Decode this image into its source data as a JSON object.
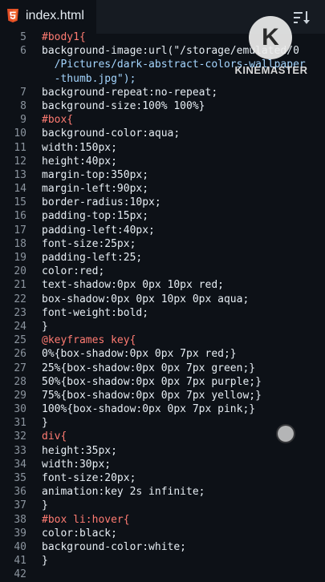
{
  "tab": {
    "title": "index.html",
    "icon": "html5-icon"
  },
  "toolbar": {
    "sort_icon": "sort-icon"
  },
  "watermark": {
    "letter": "K",
    "text": "KINEMASTER"
  },
  "code_lines": [
    {
      "n": "5",
      "text": "#body1{"
    },
    {
      "n": "6",
      "text": "background-image:url(\"/storage/emulated/0"
    },
    {
      "n": "",
      "text": "  /Pictures/dark-abstract-colors-wallpaper"
    },
    {
      "n": "",
      "text": "  -thumb.jpg\");"
    },
    {
      "n": "7",
      "text": "background-repeat:no-repeat;"
    },
    {
      "n": "8",
      "text": "background-size:100% 100%}"
    },
    {
      "n": "9",
      "text": "#box{"
    },
    {
      "n": "10",
      "text": "background-color:aqua;"
    },
    {
      "n": "11",
      "text": "width:150px;"
    },
    {
      "n": "12",
      "text": "height:40px;"
    },
    {
      "n": "13",
      "text": "margin-top:350px;"
    },
    {
      "n": "14",
      "text": "margin-left:90px;"
    },
    {
      "n": "15",
      "text": "border-radius:10px;"
    },
    {
      "n": "16",
      "text": "padding-top:15px;"
    },
    {
      "n": "17",
      "text": "padding-left:40px;"
    },
    {
      "n": "18",
      "text": "font-size:25px;"
    },
    {
      "n": "19",
      "text": "padding-left:25;"
    },
    {
      "n": "20",
      "text": "color:red;"
    },
    {
      "n": "21",
      "text": "text-shadow:0px 0px 10px red;"
    },
    {
      "n": "22",
      "text": "box-shadow:0px 0px 10px 0px aqua;"
    },
    {
      "n": "23",
      "text": "font-weight:bold;"
    },
    {
      "n": "24",
      "text": "}"
    },
    {
      "n": "25",
      "text": "@keyframes key{"
    },
    {
      "n": "26",
      "text": "0%{box-shadow:0px 0px 7px red;}"
    },
    {
      "n": "27",
      "text": "25%{box-shadow:0px 0px 7px green;}"
    },
    {
      "n": "28",
      "text": "50%{box-shadow:0px 0px 7px purple;}"
    },
    {
      "n": "29",
      "text": "75%{box-shadow:0px 0px 7px yellow;}"
    },
    {
      "n": "30",
      "text": "100%{box-shadow:0px 0px 7px pink;}"
    },
    {
      "n": "31",
      "text": "}"
    },
    {
      "n": "32",
      "text": "div{"
    },
    {
      "n": "33",
      "text": "height:35px;"
    },
    {
      "n": "34",
      "text": "width:30px;"
    },
    {
      "n": "35",
      "text": "font-size:20px;"
    },
    {
      "n": "36",
      "text": "animation:key 2s infinite;"
    },
    {
      "n": "37",
      "text": "}"
    },
    {
      "n": "38",
      "text": "#box li:hover{"
    },
    {
      "n": "39",
      "text": "color:black;"
    },
    {
      "n": "40",
      "text": "background-color:white;"
    },
    {
      "n": "41",
      "text": "}"
    },
    {
      "n": "42",
      "text": ""
    }
  ],
  "colors": {
    "background": "#0d1117",
    "selector": "#ff7b72",
    "string": "#a5d6ff",
    "function": "#d2a8ff",
    "text": "#e6edf3",
    "line_number": "#8b949e"
  }
}
